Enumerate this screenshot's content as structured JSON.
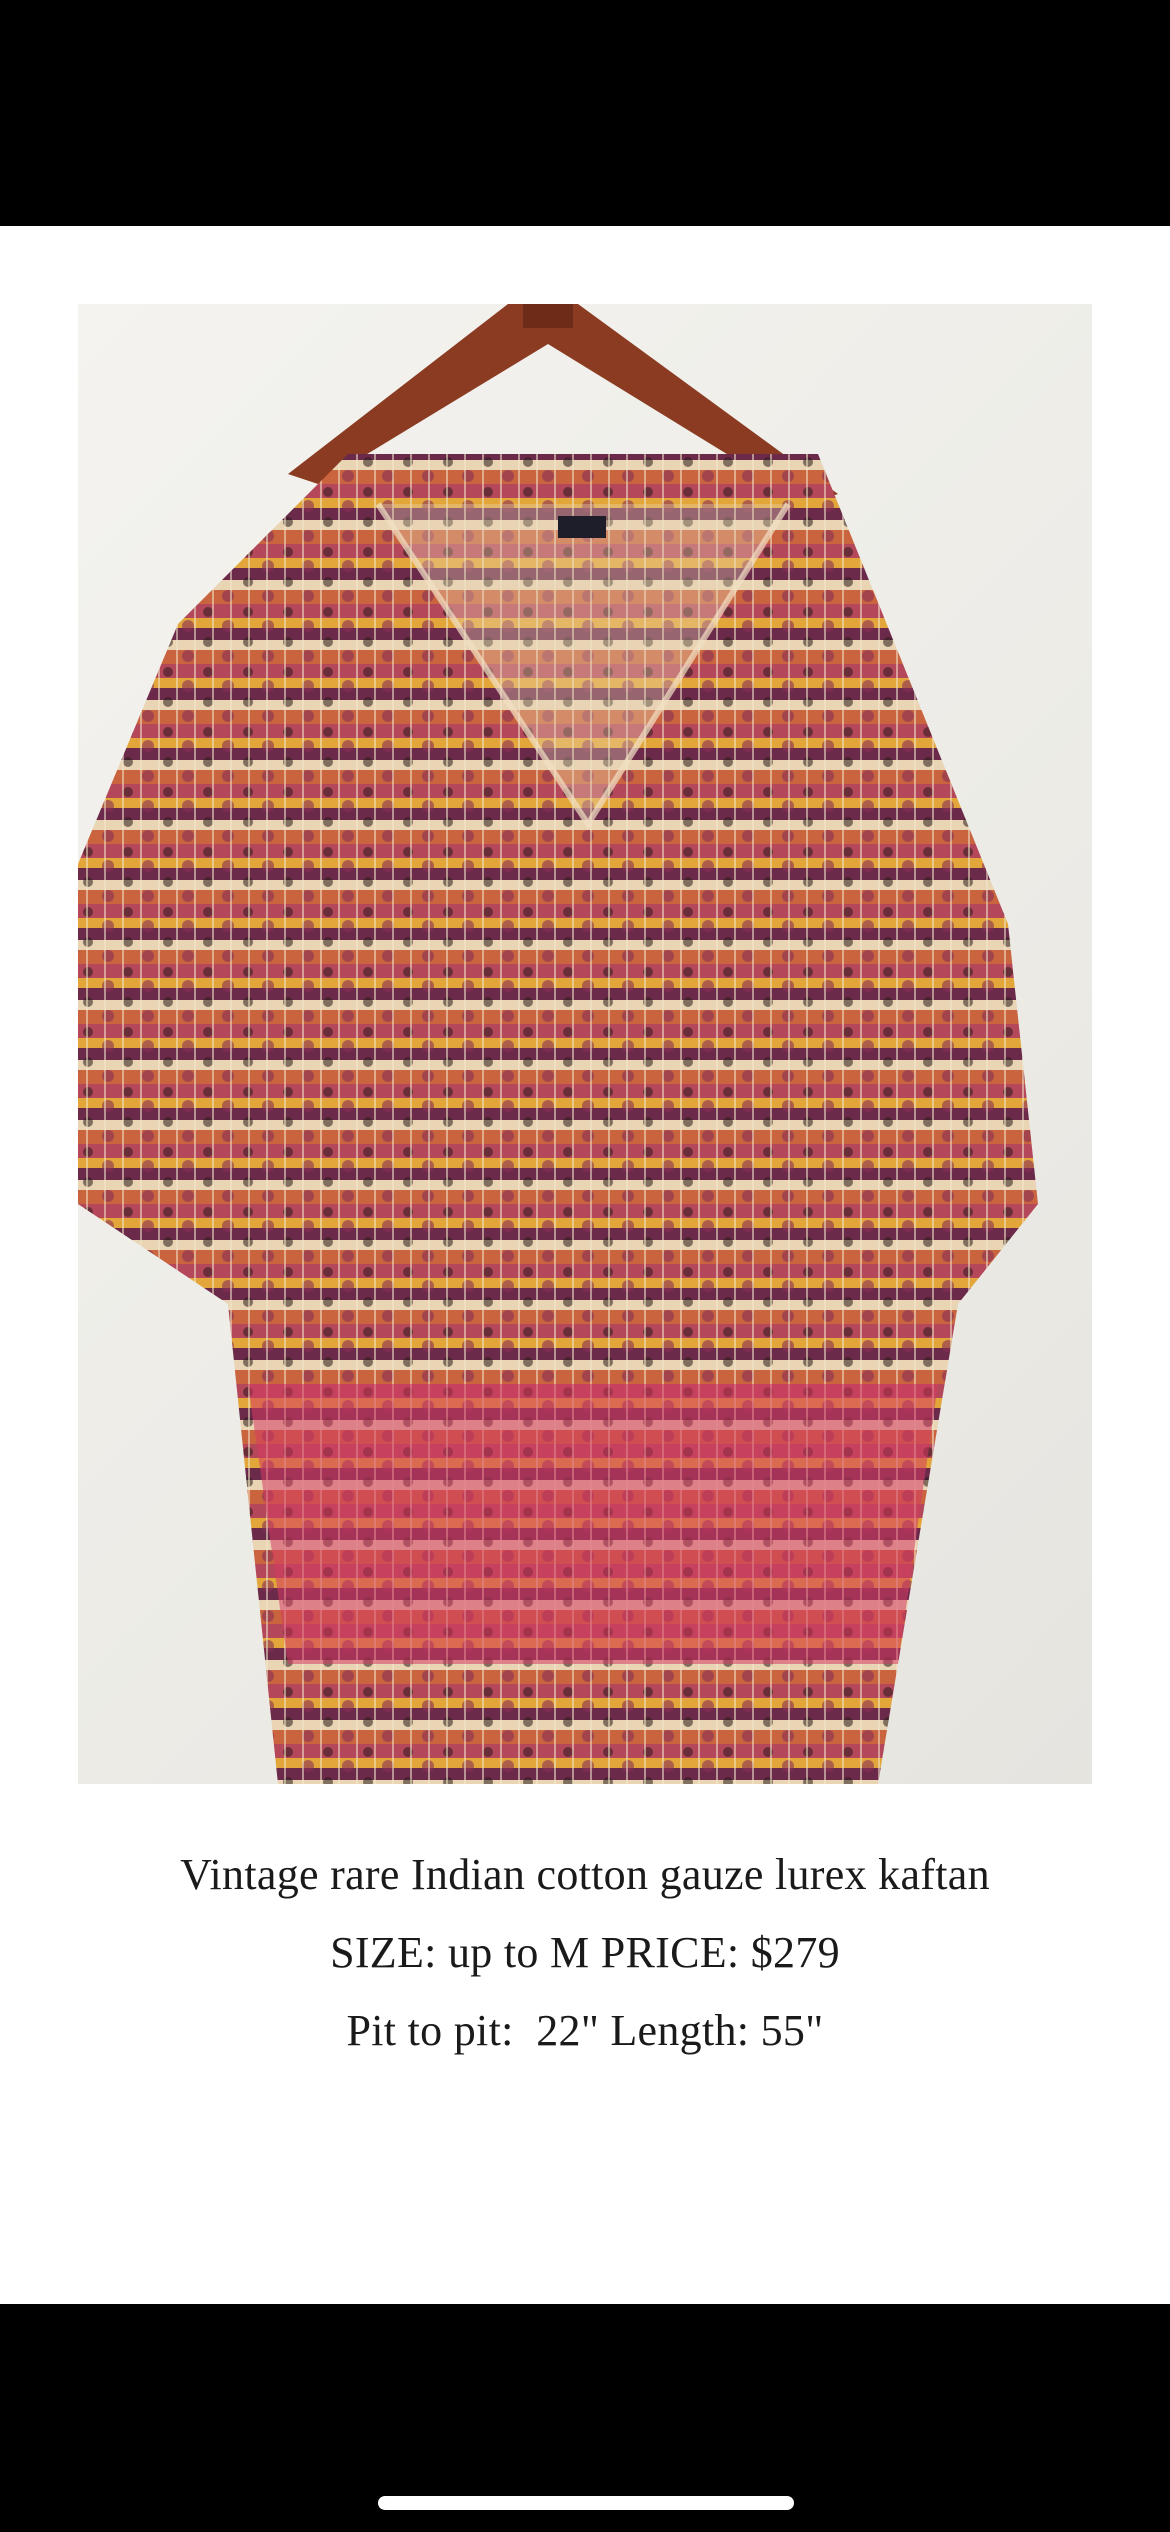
{
  "product": {
    "photo_description": "kaftan-on-hanger-photo",
    "title": "Vintage rare Indian cotton gauze lurex kaftan",
    "size_price": "SIZE: up to M PRICE: $279",
    "measurements": "Pit to pit:  22\" Length: 55\""
  },
  "colors": {
    "frame_bg": "#000000",
    "page_bg": "#ffffff",
    "text": "#1a1a1a"
  }
}
